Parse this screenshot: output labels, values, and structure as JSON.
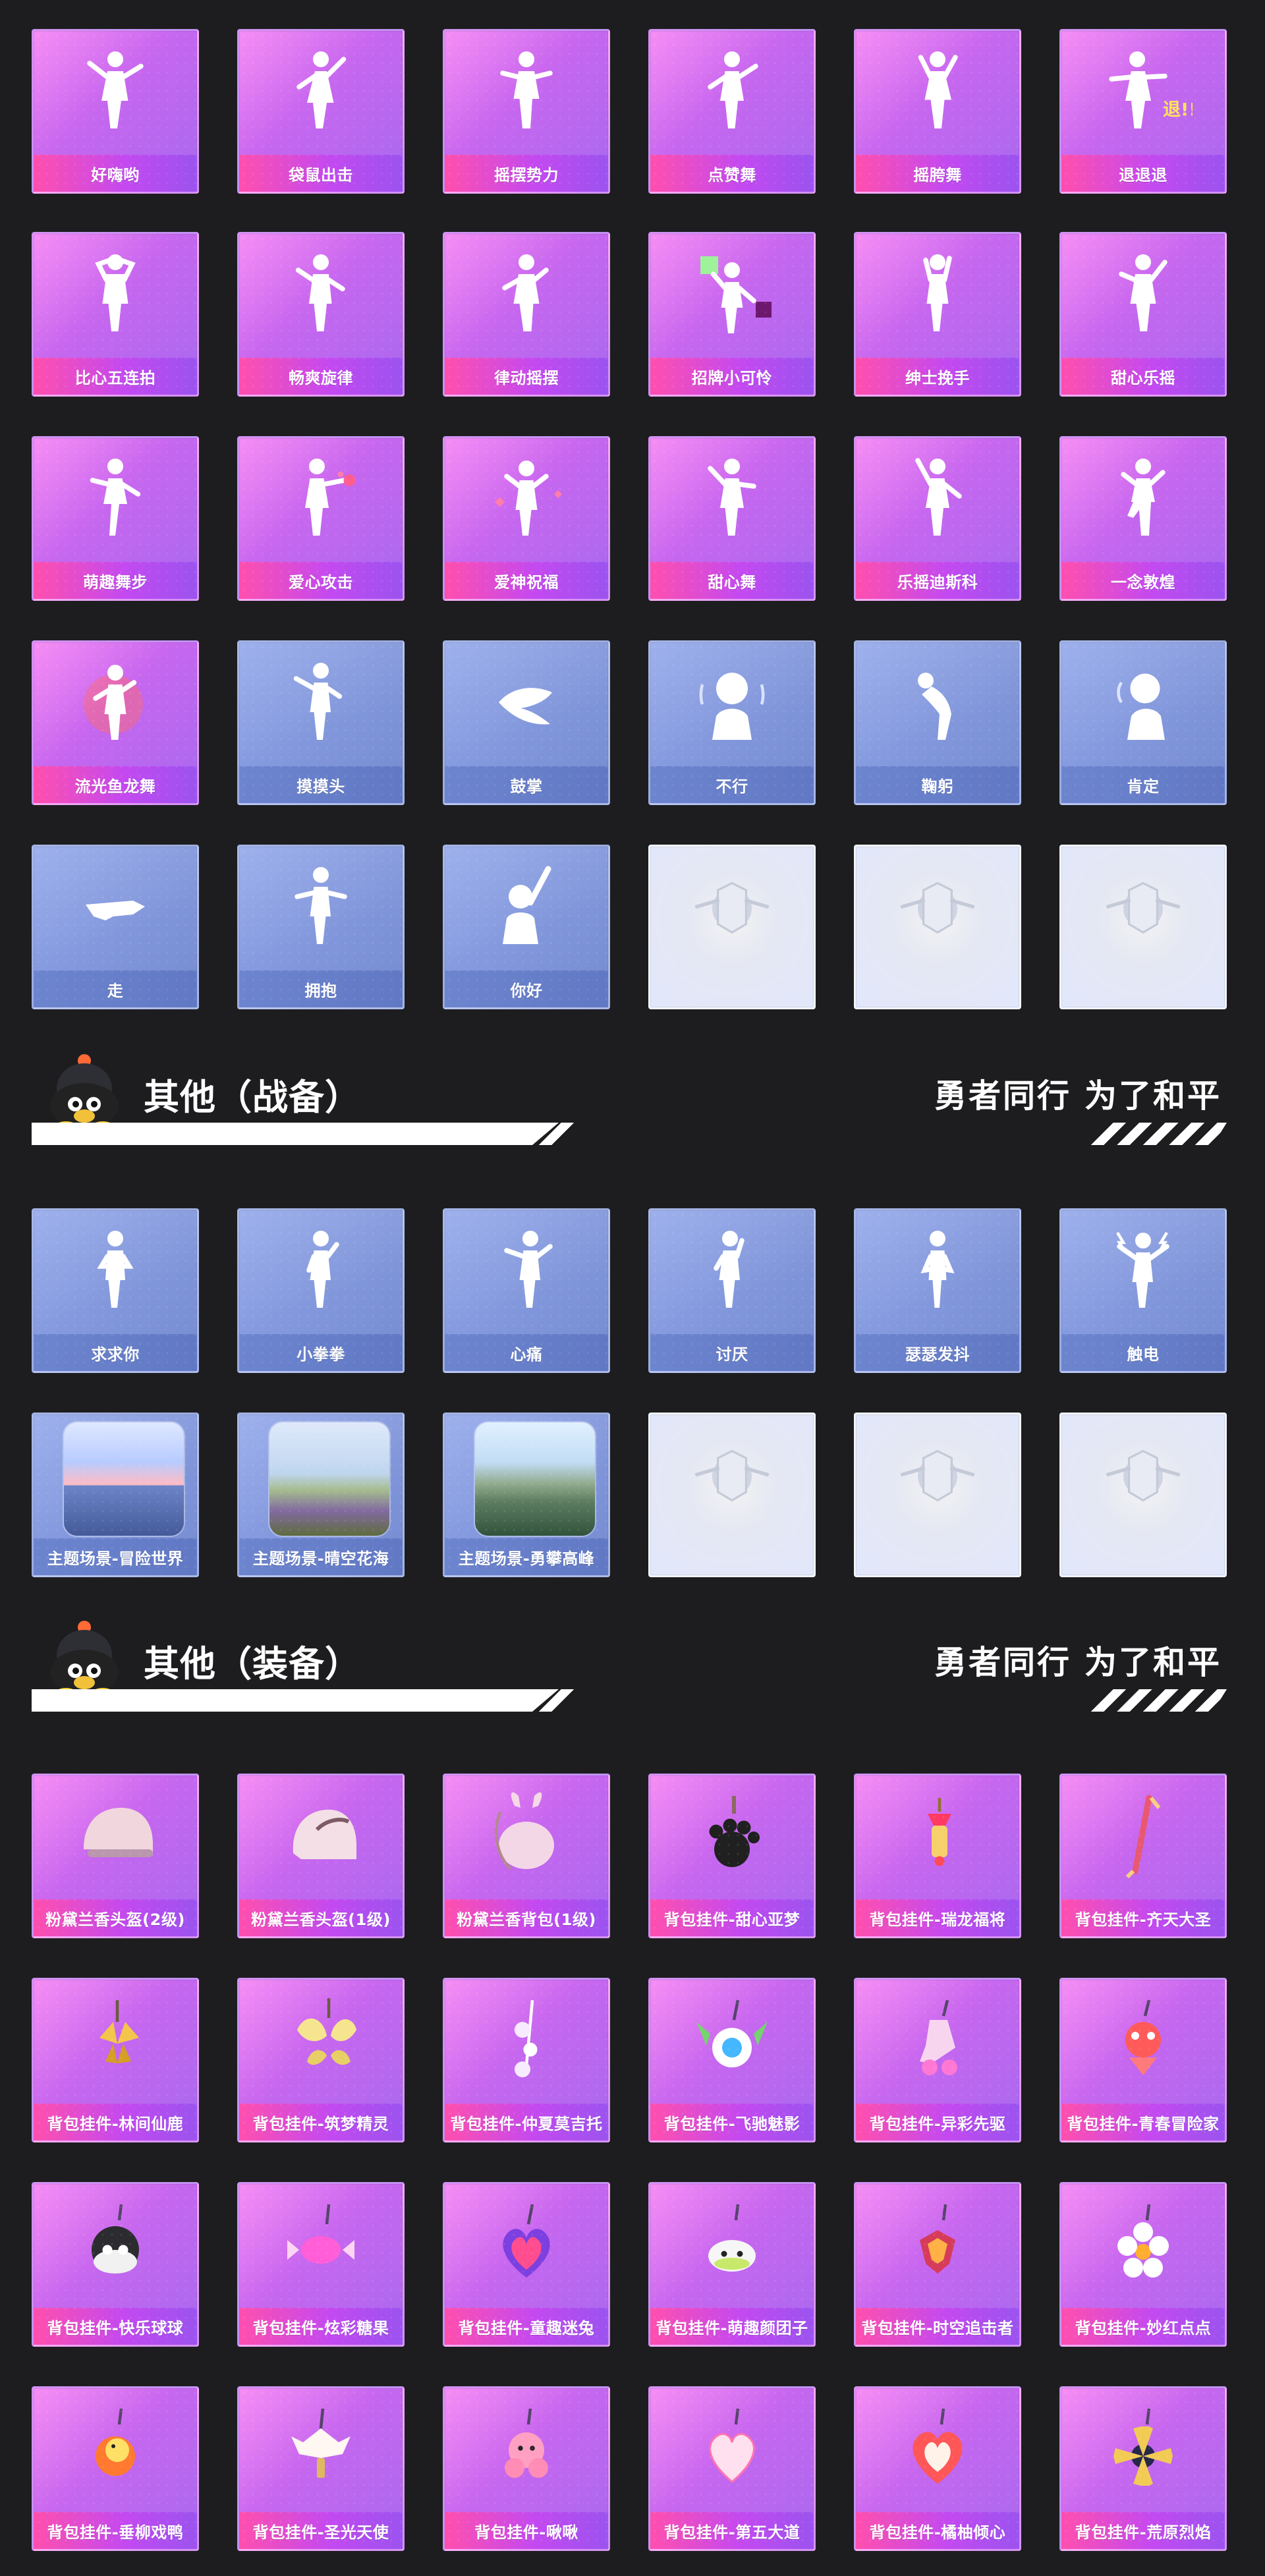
{
  "rows_top": [
    {
      "items": [
        {
          "label": "好嗨哟",
          "style": "purple",
          "icon": "dance-icon"
        },
        {
          "label": "袋鼠出击",
          "style": "purple",
          "icon": "dance-icon"
        },
        {
          "label": "摇摆势力",
          "style": "purple",
          "icon": "dance-icon"
        },
        {
          "label": "点赞舞",
          "style": "purple",
          "icon": "dance-icon"
        },
        {
          "label": "摇胯舞",
          "style": "purple",
          "icon": "dance-icon"
        },
        {
          "label": "退退退",
          "style": "purple",
          "icon": "dance-icon",
          "badge": "退!!"
        }
      ]
    },
    {
      "items": [
        {
          "label": "比心五连拍",
          "style": "purple",
          "icon": "dance-icon"
        },
        {
          "label": "畅爽旋律",
          "style": "purple",
          "icon": "dance-icon"
        },
        {
          "label": "律动摇摆",
          "style": "purple",
          "icon": "dance-icon"
        },
        {
          "label": "招牌小可怜",
          "style": "purple",
          "icon": "dance-icon"
        },
        {
          "label": "绅士挽手",
          "style": "purple",
          "icon": "dance-icon"
        },
        {
          "label": "甜心乐摇",
          "style": "purple",
          "icon": "dance-icon"
        }
      ]
    },
    {
      "items": [
        {
          "label": "萌趣舞步",
          "style": "purple",
          "icon": "dance-icon"
        },
        {
          "label": "爱心攻击",
          "style": "purple",
          "icon": "dance-icon"
        },
        {
          "label": "爱神祝福",
          "style": "purple",
          "icon": "dance-icon"
        },
        {
          "label": "甜心舞",
          "style": "purple",
          "icon": "dance-icon"
        },
        {
          "label": "乐摇迪斯科",
          "style": "purple",
          "icon": "dance-icon"
        },
        {
          "label": "一念敦煌",
          "style": "purple",
          "icon": "dance-icon"
        }
      ]
    },
    {
      "items": [
        {
          "label": "流光鱼龙舞",
          "style": "purple",
          "icon": "dragon-dance-icon"
        },
        {
          "label": "摸摸头",
          "style": "blue",
          "icon": "gesture-icon"
        },
        {
          "label": "鼓掌",
          "style": "blue",
          "icon": "clap-icon"
        },
        {
          "label": "不行",
          "style": "blue",
          "icon": "shake-head-icon"
        },
        {
          "label": "鞠躬",
          "style": "blue",
          "icon": "bow-icon"
        },
        {
          "label": "肯定",
          "style": "blue",
          "icon": "nod-icon"
        }
      ]
    },
    {
      "items": [
        {
          "label": "走",
          "style": "blue",
          "icon": "point-icon"
        },
        {
          "label": "拥抱",
          "style": "blue",
          "icon": "hug-icon"
        },
        {
          "label": "你好",
          "style": "blue",
          "icon": "wave-icon"
        },
        {
          "label": "",
          "style": "placeholder",
          "icon": "emblem-icon"
        },
        {
          "label": "",
          "style": "placeholder",
          "icon": "emblem-icon"
        },
        {
          "label": "",
          "style": "placeholder",
          "icon": "emblem-icon"
        }
      ]
    }
  ],
  "section_war": {
    "title": "其他（战备）",
    "slogan": "勇者同行 为了和平",
    "mascot_icon": "mascot-icon",
    "rows": [
      {
        "items": [
          {
            "label": "求求你",
            "style": "blue",
            "icon": "beg-icon"
          },
          {
            "label": "小拳拳",
            "style": "blue",
            "icon": "punch-icon"
          },
          {
            "label": "心痛",
            "style": "blue",
            "icon": "heartache-icon"
          },
          {
            "label": "讨厌",
            "style": "blue",
            "icon": "annoyed-icon"
          },
          {
            "label": "瑟瑟发抖",
            "style": "blue",
            "icon": "shiver-icon"
          },
          {
            "label": "触电",
            "style": "blue",
            "icon": "shock-icon"
          }
        ]
      },
      {
        "items": [
          {
            "label": "主题场景-冒险世界",
            "style": "blue",
            "icon": "scene-ocean-icon"
          },
          {
            "label": "主题场景-晴空花海",
            "style": "blue",
            "icon": "scene-flower-icon"
          },
          {
            "label": "主题场景-勇攀高峰",
            "style": "blue",
            "icon": "scene-mountain-icon"
          },
          {
            "label": "",
            "style": "placeholder",
            "icon": "emblem-icon"
          },
          {
            "label": "",
            "style": "placeholder",
            "icon": "emblem-icon"
          },
          {
            "label": "",
            "style": "placeholder",
            "icon": "emblem-icon"
          }
        ]
      }
    ]
  },
  "section_gear": {
    "title": "其他（装备）",
    "slogan": "勇者同行 为了和平",
    "mascot_icon": "mascot-icon",
    "rows": [
      {
        "items": [
          {
            "label": "粉黛兰香头盔(2级)",
            "style": "purple",
            "icon": "helmet-icon"
          },
          {
            "label": "粉黛兰香头盔(1级)",
            "style": "purple",
            "icon": "helmet-icon"
          },
          {
            "label": "粉黛兰香背包(1级)",
            "style": "purple",
            "icon": "backpack-icon"
          },
          {
            "label": "背包挂件-甜心亚梦",
            "style": "purple",
            "icon": "paw-charm-icon"
          },
          {
            "label": "背包挂件-瑞龙福将",
            "style": "purple",
            "icon": "charm-icon"
          },
          {
            "label": "背包挂件-齐天大圣",
            "style": "purple",
            "icon": "charm-icon"
          }
        ]
      },
      {
        "items": [
          {
            "label": "背包挂件-林间仙鹿",
            "style": "purple",
            "icon": "charm-icon"
          },
          {
            "label": "背包挂件-筑梦精灵",
            "style": "purple",
            "icon": "charm-icon"
          },
          {
            "label": "背包挂件-仲夏莫吉托",
            "style": "purple",
            "icon": "charm-icon"
          },
          {
            "label": "背包挂件-飞驰魅影",
            "style": "purple",
            "icon": "charm-icon"
          },
          {
            "label": "背包挂件-异彩先驱",
            "style": "purple",
            "icon": "charm-icon"
          },
          {
            "label": "背包挂件-青春冒险家",
            "style": "purple",
            "icon": "charm-icon"
          }
        ]
      },
      {
        "items": [
          {
            "label": "背包挂件-快乐球球",
            "style": "purple",
            "icon": "charm-icon"
          },
          {
            "label": "背包挂件-炫彩糖果",
            "style": "purple",
            "icon": "charm-icon"
          },
          {
            "label": "背包挂件-童趣迷兔",
            "style": "purple",
            "icon": "charm-icon"
          },
          {
            "label": "背包挂件-萌趣颜团子",
            "style": "purple",
            "icon": "charm-icon"
          },
          {
            "label": "背包挂件-时空追击者",
            "style": "purple",
            "icon": "charm-icon"
          },
          {
            "label": "背包挂件-妙红点点",
            "style": "purple",
            "icon": "charm-icon"
          }
        ]
      },
      {
        "items": [
          {
            "label": "背包挂件-垂柳戏鸭",
            "style": "purple",
            "icon": "charm-icon"
          },
          {
            "label": "背包挂件-圣光天使",
            "style": "purple",
            "icon": "charm-icon"
          },
          {
            "label": "背包挂件-啾啾",
            "style": "purple",
            "icon": "charm-icon"
          },
          {
            "label": "背包挂件-第五大道",
            "style": "purple",
            "icon": "charm-icon"
          },
          {
            "label": "背包挂件-橘柚倾心",
            "style": "purple",
            "icon": "charm-icon"
          },
          {
            "label": "背包挂件-荒原烈焰",
            "style": "purple",
            "icon": "charm-icon"
          }
        ]
      }
    ]
  }
}
